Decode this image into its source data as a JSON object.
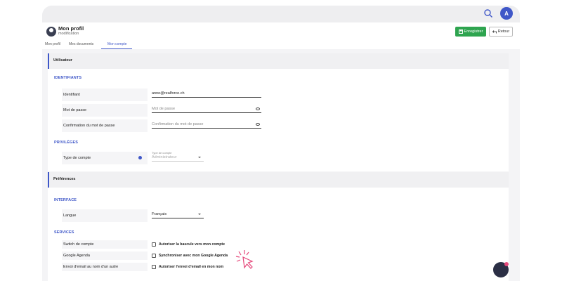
{
  "topbar": {
    "avatar_initial": "A"
  },
  "header": {
    "title": "Mon profil",
    "subtitle": "modification",
    "save_label": "Enregistrer",
    "back_label": "Retour"
  },
  "tabs": [
    {
      "label": "Mon profil"
    },
    {
      "label": "Mes documents"
    },
    {
      "label": "Mon compte"
    }
  ],
  "utilisateur": {
    "title": "Utilisateur",
    "identifiants": {
      "title": "IDENTIFIANTS",
      "identifiant_label": "Identifiant",
      "identifiant_value": "anne@realforce.ch",
      "password_label": "Mot de passe",
      "password_placeholder": "Mot de passe",
      "confirm_label": "Confirmation du mot de passe",
      "confirm_placeholder": "Confirmation du mot de passe"
    },
    "privileges": {
      "title": "PRIVILÈGES",
      "account_type_label": "Type de compte",
      "account_type_field_label": "Type de compte",
      "account_type_value": "Administrateur"
    }
  },
  "preferences": {
    "title": "Préférences",
    "interface": {
      "title": "INTERFACE",
      "language_label": "Langue",
      "language_value": "Français"
    },
    "services": {
      "title": "SERVICES",
      "rows": [
        {
          "label": "Switch de compte",
          "checkbox": "Autoriser la bascule vers mon compte",
          "checked": false
        },
        {
          "label": "Google Agenda",
          "checkbox": "Synchroniser avec mon Google Agenda",
          "checked": false
        },
        {
          "label": "Envoi d'email au nom d'un autre",
          "checkbox": "Autoriser l'envoi d'email en mon nom",
          "checked": false
        }
      ]
    }
  },
  "colors": {
    "accent": "#3f57c8",
    "save": "#2ea44f",
    "cursor": "#e5487b"
  }
}
